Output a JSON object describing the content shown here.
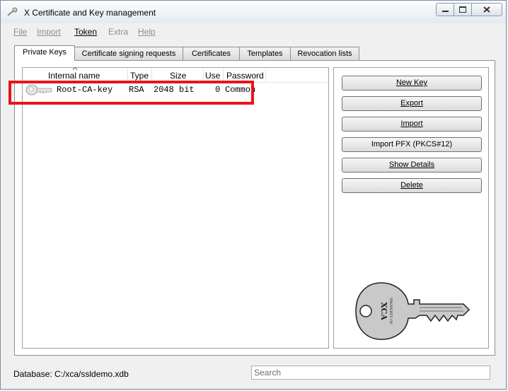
{
  "window": {
    "title": "X Certificate and Key management"
  },
  "menu": {
    "file": "File",
    "import": "Import",
    "token": "Token",
    "extra": "Extra",
    "help": "Help"
  },
  "tabs": [
    {
      "label": "Private Keys",
      "active": true
    },
    {
      "label": "Certificate signing requests"
    },
    {
      "label": "Certificates"
    },
    {
      "label": "Templates"
    },
    {
      "label": "Revocation lists"
    }
  ],
  "table": {
    "headers": [
      "Internal name",
      "Type",
      "Size",
      "Use",
      "Password"
    ],
    "rows": [
      {
        "internal_name": "Root-CA-key",
        "type": "RSA",
        "size": "2048 bit",
        "use": "0",
        "password": "Common"
      }
    ]
  },
  "buttons": {
    "new_key": "New Key",
    "export": "Export",
    "import": "Import",
    "import_pfx": "Import PFX (PKCS#12)",
    "show_details": "Show Details",
    "delete": "Delete"
  },
  "logo": {
    "line1": "PROPERTY OF",
    "line2": "XCA"
  },
  "status": {
    "database": "Database: C:/xca/ssldemo.xdb"
  },
  "search": {
    "placeholder": "Search"
  },
  "colors": {
    "highlight": "#e8141b",
    "titlebar": "#eef1f6"
  }
}
